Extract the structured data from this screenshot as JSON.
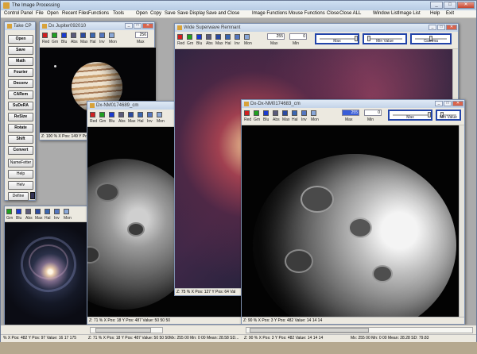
{
  "app": {
    "title": "The Image Processing"
  },
  "menu": [
    "Control Panel",
    "File",
    "Open",
    "Recent Files",
    "Functions",
    "Tools",
    "Open",
    "Copy",
    "Save",
    "Save Display",
    "Save and Close",
    "Image Functions",
    "Mouse Functions",
    "Close",
    "Close ALL",
    "Window List",
    "Image List",
    "Help",
    "Exit"
  ],
  "window_buttons": {
    "min": "_",
    "max": "□",
    "close": "✕"
  },
  "control_panel": {
    "title": "Take CP",
    "buttons": [
      "Open",
      "Save",
      "Math",
      "Fourier",
      "Deconv",
      "CARem",
      "SuDeRA",
      "ReSize",
      "Rotate",
      "Shift",
      "Convert",
      "NameFetter",
      "Help",
      "Helv",
      "Define"
    ]
  },
  "swatch_labels": [
    "Red",
    "Grn",
    "Blu",
    "Abs",
    "Max",
    "Hal",
    "Inv",
    "Mon"
  ],
  "colors": {
    "swatches": [
      "#d22020",
      "#20a020",
      "#1a3bd0",
      "#5a5a7a",
      "#2a4aa0",
      "#3a66b0",
      "#5577c0",
      "#8aa8d8"
    ]
  },
  "win_jupiter": {
    "title": "Dx Jupiter092010",
    "status": "Z: 100 %  X Pos: 149  Y Pos: 86",
    "field": "256",
    "maxlabel": "Max"
  },
  "win_galaxy": {
    "status": "%  X Pos: 482  Y Pos: 97  Value: 16  17  175"
  },
  "win_moon1": {
    "title": "Dx-NM0174689_cm",
    "status": "Z: 71 %  X Pos: 18  Y Pos: 487  Value: 50 50 50"
  },
  "win_milky": {
    "title": "Wide Superwave Remnant",
    "status": "Z: 75 %  X Pos: 127  Y Pos: 64  Val",
    "fields": [
      "255",
      "0"
    ],
    "field_labels": [
      "Max",
      "Min"
    ],
    "slider_caps": [
      "Max",
      "Min Value",
      "Gamma"
    ]
  },
  "win_moon2": {
    "title": "Dx-Dx-NM0174683_cm",
    "status": "Z: 90 %  X Pos: 3  Y Pos: 482  Value: 14  14  14",
    "fields": [
      "255",
      "0"
    ],
    "field_labels": [
      "Max",
      "Min"
    ],
    "slider_caps": [
      "Max",
      "Min Value"
    ]
  },
  "status_bottom": [
    "Mx: 255 00 Mn: 0 00 Mean: 28.58 SD...",
    "Mx: 255 00 Mn: 0 00 Mean: 28.28 SD: 79.83"
  ]
}
